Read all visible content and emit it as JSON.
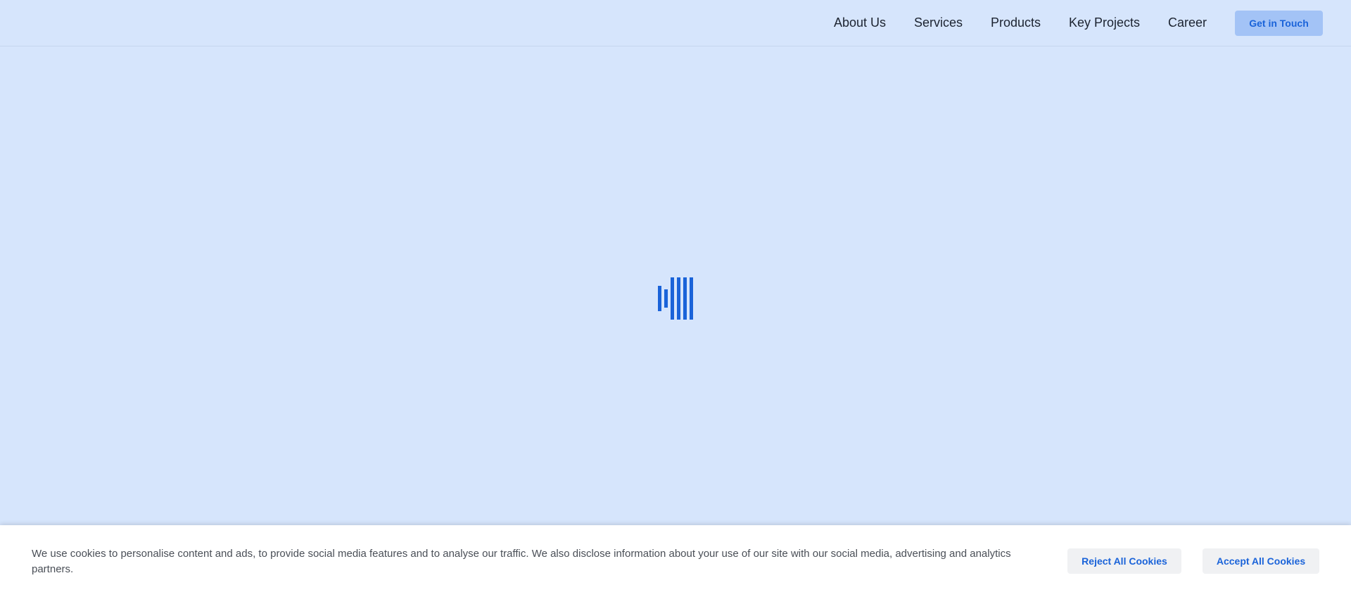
{
  "nav": {
    "items": [
      {
        "label": "About Us"
      },
      {
        "label": "Services"
      },
      {
        "label": "Products"
      },
      {
        "label": "Key Projects"
      },
      {
        "label": "Career"
      }
    ],
    "cta_label": "Get in Touch"
  },
  "loader": {
    "icon": "loading-bars-icon",
    "color": "#1a63d9"
  },
  "cookie_banner": {
    "text": "We use cookies to personalise content and ads, to provide social media features and to analyse our traffic. We also disclose information about your use of our site with our social media, advertising and analytics partners.",
    "reject_label": "Reject All Cookies",
    "accept_label": "Accept All Cookies"
  },
  "colors": {
    "background": "#d6e5fc",
    "accent": "#1a63d9",
    "cta_background": "#a3c3f6"
  }
}
